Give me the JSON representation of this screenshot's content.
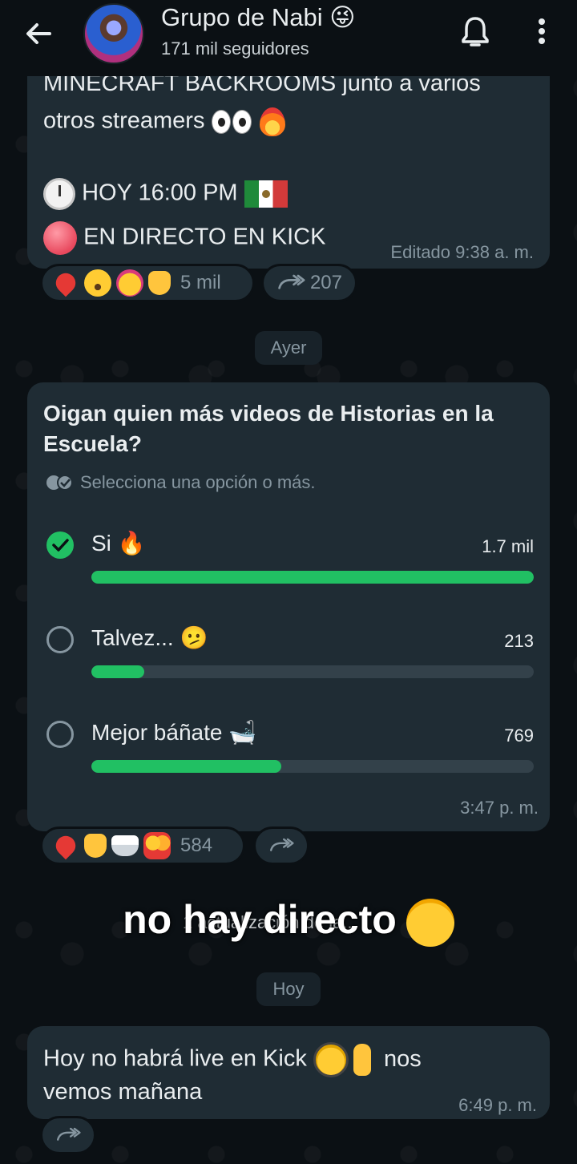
{
  "header": {
    "back_icon": "arrow-left-icon",
    "title": "Grupo de Nabi 😜",
    "subtitle": "171 mil seguidores",
    "bell_icon": "bell-icon",
    "menu_icon": "more-vert-icon"
  },
  "post1": {
    "line1": "MINECRAFT BACKROOMS junto a varios",
    "line2": "otros streamers",
    "line3": "HOY 16:00 PM",
    "line4": "EN DIRECTO EN KICK",
    "edited_label": "Editado",
    "time": "9:38 a. m.",
    "reactions_count": "5 mil",
    "forwards_count": "207"
  },
  "date_chip_1": "Ayer",
  "poll": {
    "question": "Oigan quien más videos de Historias en la Escuela?",
    "hint": "Selecciona una opción o más.",
    "options": [
      {
        "label": "Si 🔥",
        "votes": "1.7 mil",
        "fraction": 1.0,
        "checked": true
      },
      {
        "label": "Talvez... 🫤",
        "votes": "213",
        "fraction": 0.12,
        "checked": false
      },
      {
        "label": "Mejor báñate 🛁",
        "votes": "769",
        "fraction": 0.43,
        "checked": false
      }
    ],
    "time": "3:47 p. m.",
    "reactions_count": "584"
  },
  "system_message": "1 actualización de la...",
  "overlay_caption": "no hay directo",
  "date_chip_2": "Hoy",
  "post3": {
    "line1a": "Hoy no habrá live en Kick",
    "line1b": "nos",
    "line2": "vemos mañana",
    "time": "6:49 p. m."
  },
  "colors": {
    "background": "#0b1014",
    "bubble": "#1f2c34",
    "accent_green": "#21c063",
    "meta_text": "#8696a0"
  }
}
